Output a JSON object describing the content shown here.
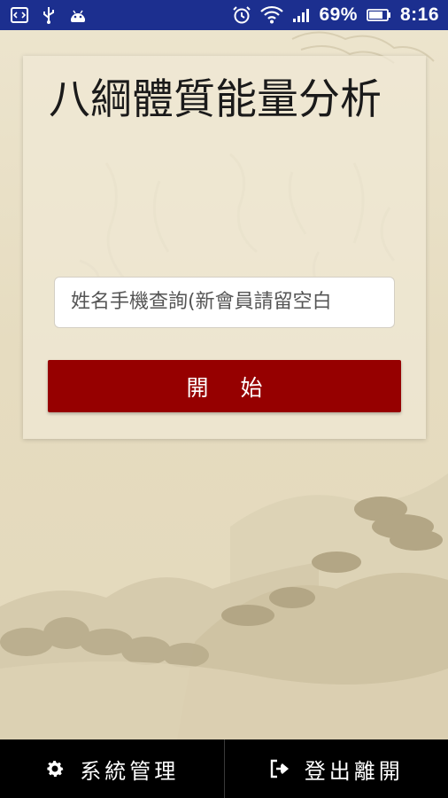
{
  "status_bar": {
    "battery": "69%",
    "time": "8:16",
    "wifi_label": "wifi-icon"
  },
  "main": {
    "title": "八綱體質能量分析",
    "search_placeholder": "姓名手機查詢(新會員請留空白",
    "start_label": "開 始"
  },
  "bottom_nav": {
    "items": [
      {
        "label": "系統管理",
        "icon": "gear-icon"
      },
      {
        "label": "登出離開",
        "icon": "sign-out-icon"
      }
    ]
  },
  "colors": {
    "status_bar": "#1c2f8f",
    "start_button": "#960000",
    "background": "#e9e0c8",
    "bottom_bar": "#000000"
  }
}
